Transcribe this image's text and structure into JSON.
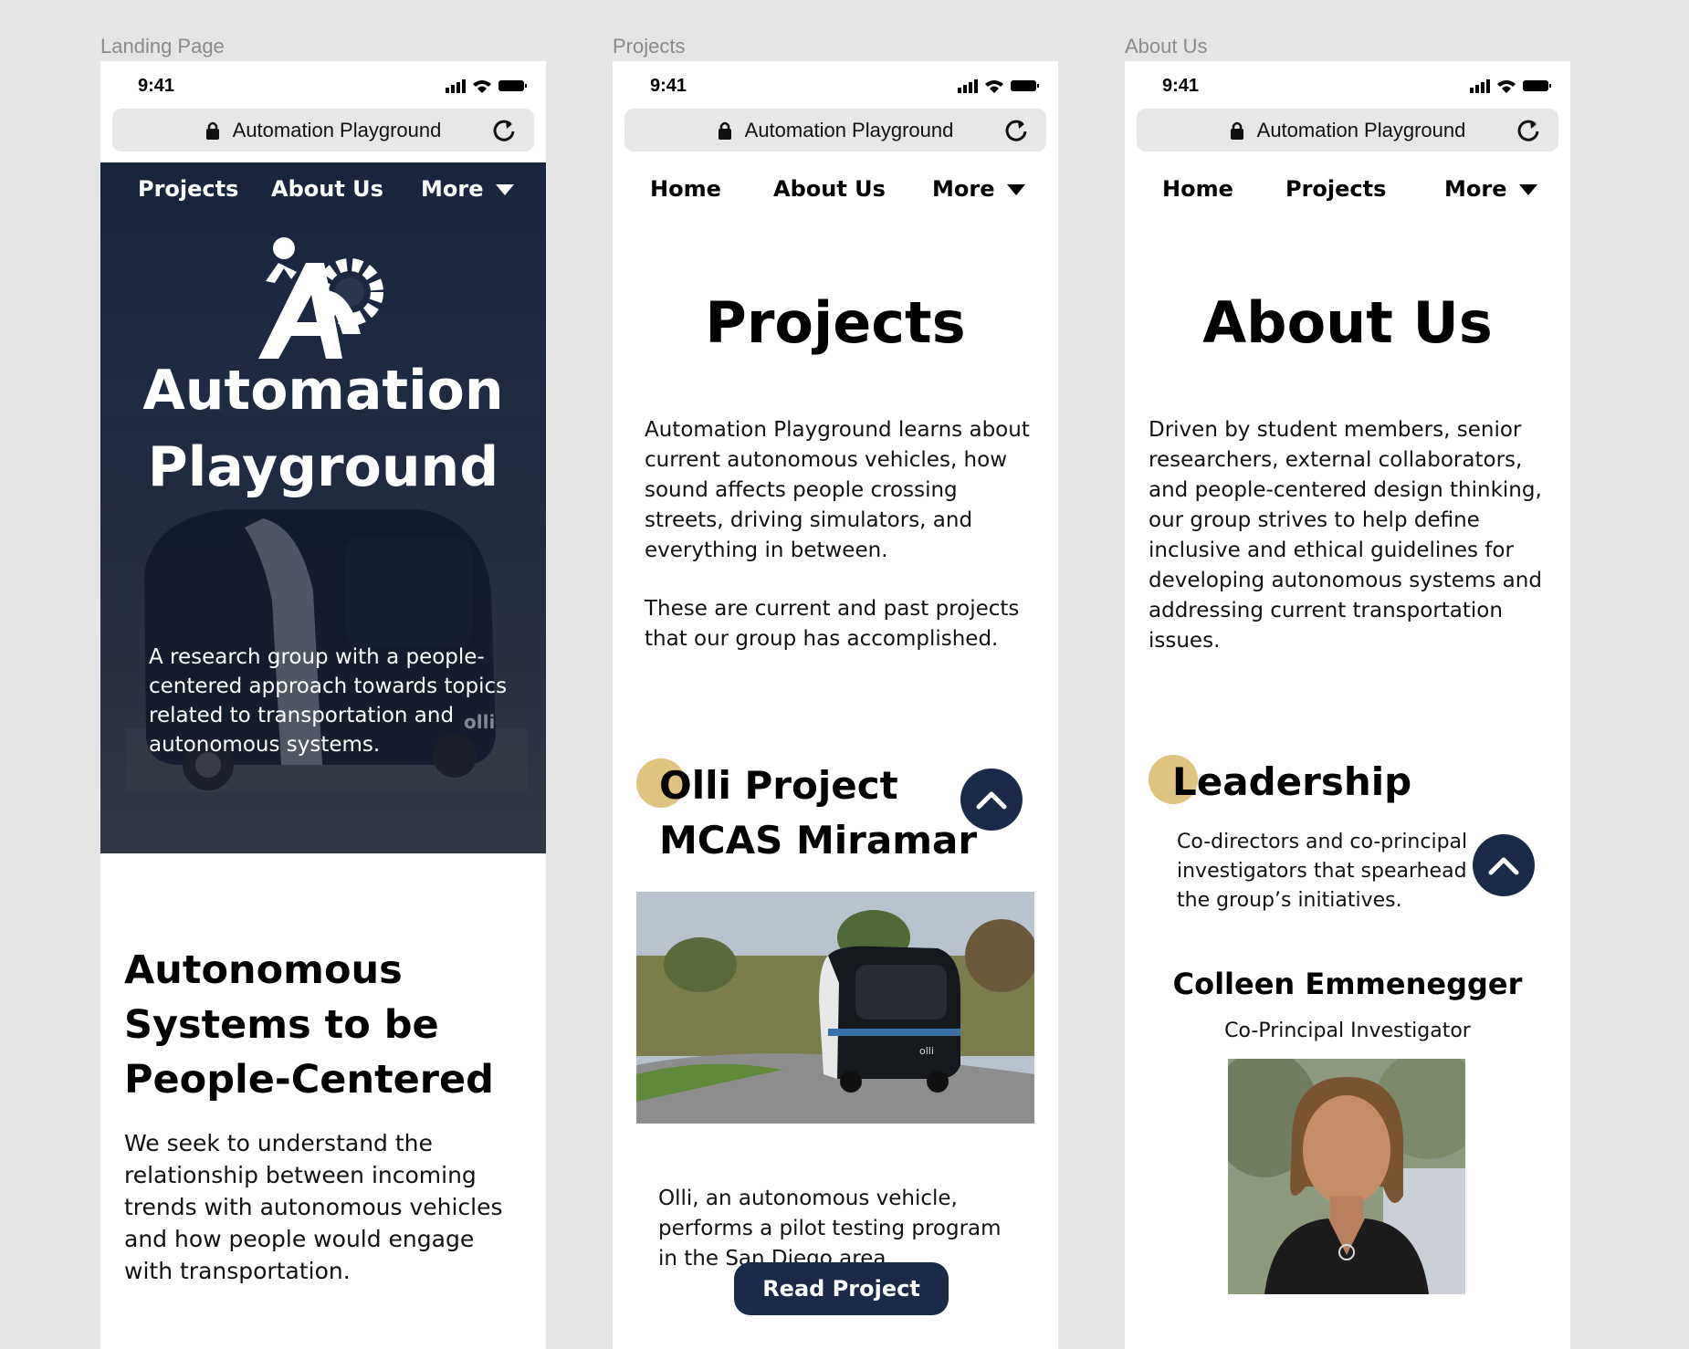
{
  "frames": {
    "landing": {
      "label": "Landing Page",
      "time": "9:41",
      "url": "Automation Playground",
      "nav": [
        "Projects",
        "About Us",
        "More"
      ],
      "hero": {
        "title_line1": "Automation",
        "title_line2": "Playground",
        "subtitle": "A research group with a people-centered approach towards topics related to transportation and autonomous systems."
      },
      "section": {
        "heading_line1": "Autonomous",
        "heading_line2": "Systems to be",
        "heading_line3": "People-Centered",
        "body": "We seek to understand the relationship between incoming trends with autonomous vehicles and how people would engage with transportation."
      }
    },
    "projects": {
      "label": "Projects",
      "time": "9:41",
      "url": "Automation Playground",
      "nav": [
        "Home",
        "About Us",
        "More"
      ],
      "title": "Projects",
      "intro1": "Automation Playground learns about current autonomous vehicles, how sound affects people crossing streets, driving simulators, and everything in between.",
      "intro2": "These are current and past projects that our group has accomplished.",
      "project": {
        "title_line1": "Olli Project",
        "title_line2": "MCAS Miramar",
        "description": "Olli, an autonomous vehicle, performs a pilot testing program in the San Diego area.",
        "button": "Read Project"
      }
    },
    "about": {
      "label": "About Us",
      "time": "9:41",
      "url": "Automation Playground",
      "nav": [
        "Home",
        "Projects",
        "More"
      ],
      "title": "About Us",
      "body": "Driven by student members, senior researchers, external collaborators, and people-centered design thinking, our group strives to help define inclusive and ethical guidelines for developing autonomous systems and addressing current transportation issues.",
      "leadership": {
        "heading": "Leadership",
        "description": "Co-directors and co-principal investigators that spearhead the group’s initiatives.",
        "person_name": "Colleen Emmenegger",
        "person_role": "Co-Principal Investigator"
      }
    }
  },
  "colors": {
    "navy": "#1b2a4a",
    "gold": "#e0c37e",
    "canvas": "#e5e5e5"
  },
  "icons": [
    "lock-icon",
    "reload-icon",
    "chevron-down-icon",
    "chevron-up-icon",
    "signal-icon",
    "wifi-icon",
    "battery-icon",
    "ap-logo-icon"
  ]
}
